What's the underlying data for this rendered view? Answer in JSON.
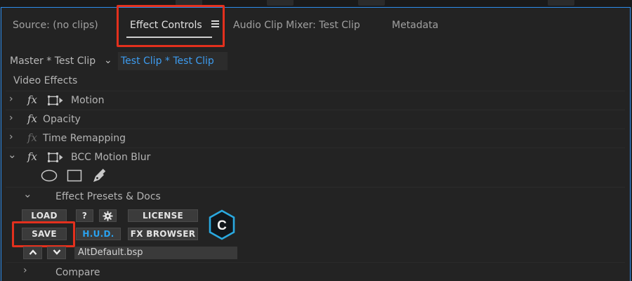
{
  "tabs": [
    {
      "label": "Source: (no clips)"
    },
    {
      "label": "Effect Controls"
    },
    {
      "label": "Audio Clip Mixer: Test Clip"
    },
    {
      "label": "Metadata"
    }
  ],
  "clip_selector": {
    "master": "Master * Test Clip",
    "active": "Test Clip * Test Clip"
  },
  "section_header": "Video Effects",
  "effects": [
    {
      "name": "Motion"
    },
    {
      "name": "Opacity"
    },
    {
      "name": "Time Remapping"
    },
    {
      "name": "BCC Motion Blur"
    }
  ],
  "presets": {
    "title": "Effect Presets & Docs",
    "load": "LOAD",
    "help": "?",
    "license": "LICENSE",
    "save": "SAVE",
    "hud": "H.U.D.",
    "fx_browser": "FX BROWSER",
    "preset_file": "AltDefault.bsp",
    "logo_letter": "C"
  },
  "compare": "Compare",
  "colors": {
    "accent_blue": "#2d8ceb",
    "highlight_red": "#e3301d",
    "hud_blue": "#2aa2ef",
    "logo_cyan": "#2aa9e0"
  }
}
